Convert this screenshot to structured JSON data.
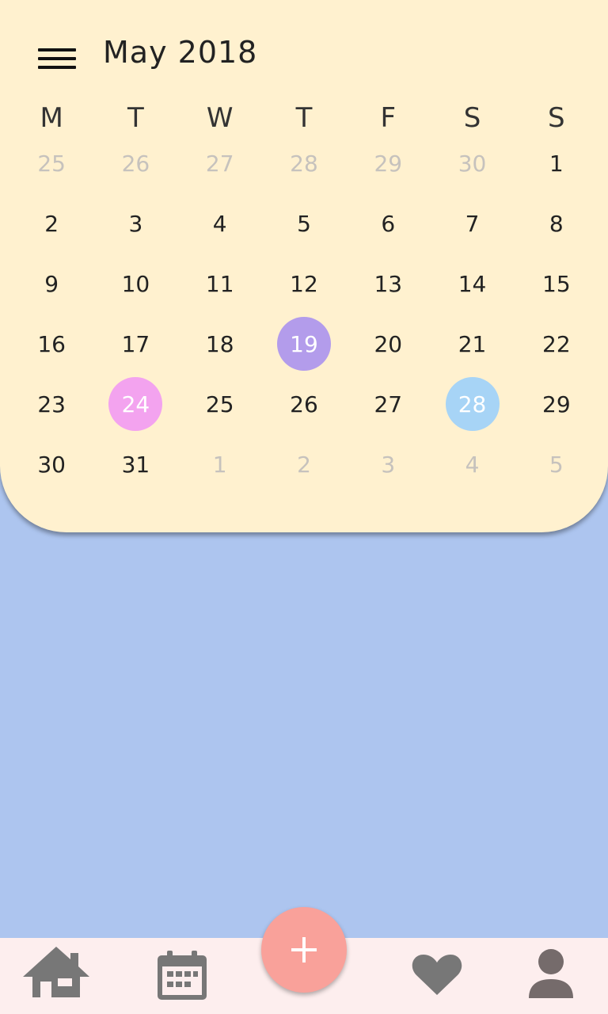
{
  "header": {
    "title": "May 2018"
  },
  "weekdays": [
    "M",
    "T",
    "W",
    "T",
    "F",
    "S",
    "S"
  ],
  "days": [
    {
      "label": "25",
      "muted": true
    },
    {
      "label": "26",
      "muted": true
    },
    {
      "label": "27",
      "muted": true
    },
    {
      "label": "28",
      "muted": true
    },
    {
      "label": "29",
      "muted": true
    },
    {
      "label": "30",
      "muted": true
    },
    {
      "label": "1",
      "muted": false
    },
    {
      "label": "2",
      "muted": false
    },
    {
      "label": "3",
      "muted": false
    },
    {
      "label": "4",
      "muted": false
    },
    {
      "label": "5",
      "muted": false
    },
    {
      "label": "6",
      "muted": false
    },
    {
      "label": "7",
      "muted": false
    },
    {
      "label": "8",
      "muted": false
    },
    {
      "label": "9",
      "muted": false
    },
    {
      "label": "10",
      "muted": false
    },
    {
      "label": "11",
      "muted": false
    },
    {
      "label": "12",
      "muted": false
    },
    {
      "label": "13",
      "muted": false
    },
    {
      "label": "14",
      "muted": false
    },
    {
      "label": "15",
      "muted": false
    },
    {
      "label": "16",
      "muted": false
    },
    {
      "label": "17",
      "muted": false
    },
    {
      "label": "18",
      "muted": false
    },
    {
      "label": "19",
      "muted": false,
      "highlight": "#b39ceb"
    },
    {
      "label": "20",
      "muted": false
    },
    {
      "label": "21",
      "muted": false
    },
    {
      "label": "22",
      "muted": false
    },
    {
      "label": "23",
      "muted": false
    },
    {
      "label": "24",
      "muted": false,
      "highlight": "#f3a3ef"
    },
    {
      "label": "25",
      "muted": false
    },
    {
      "label": "26",
      "muted": false
    },
    {
      "label": "27",
      "muted": false
    },
    {
      "label": "28",
      "muted": false,
      "highlight": "#a7d4f6"
    },
    {
      "label": "29",
      "muted": false
    },
    {
      "label": "30",
      "muted": false
    },
    {
      "label": "31",
      "muted": false
    },
    {
      "label": "1",
      "muted": true
    },
    {
      "label": "2",
      "muted": true
    },
    {
      "label": "3",
      "muted": true
    },
    {
      "label": "4",
      "muted": true
    },
    {
      "label": "5",
      "muted": true
    }
  ],
  "bottom_nav": {
    "items": [
      "home-icon",
      "calendar-icon",
      "heart-icon",
      "person-icon"
    ],
    "fab": {
      "label": "+",
      "color": "#f9a19a"
    }
  },
  "colors": {
    "calendar_bg": "#fff1cf",
    "page_bg": "#adc5ef",
    "bottom_bar_bg": "#fdeeee",
    "icon_gray": "#777777"
  }
}
